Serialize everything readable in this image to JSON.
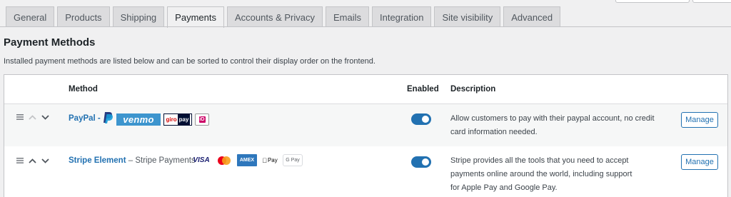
{
  "tabs": [
    "General",
    "Products",
    "Shipping",
    "Payments",
    "Accounts & Privacy",
    "Emails",
    "Integration",
    "Site visibility",
    "Advanced"
  ],
  "active_tab": "Payments",
  "page": {
    "title": "Payment Methods",
    "description": "Installed payment methods are listed below and can be sorted to control their display order on the frontend."
  },
  "table": {
    "headers": {
      "method": "Method",
      "enabled": "Enabled",
      "description": "Description"
    },
    "rows": [
      {
        "name": "PayPal -",
        "subtitle": "",
        "logos": [
          "paypal-logo",
          "venmo-logo",
          "giropay-logo",
          "ideal-logo"
        ],
        "logo_text": {
          "venmo": "venmo",
          "giropay_1": "giro",
          "giropay_2": "pay",
          "ideal": "iD"
        },
        "enabled": true,
        "description": "Allow customers to pay with their paypal account, no credit card information needed.",
        "manage_label": "Manage"
      },
      {
        "name": "Stripe Element",
        "subtitle": "– Stripe Payments",
        "logos": [
          "visa-logo",
          "mastercard-logo",
          "amex-logo",
          "apple-pay-logo",
          "google-pay-logo"
        ],
        "logo_text": {
          "visa": "VISA",
          "amex": "AMEX",
          "applepay": "Pay",
          "gpay": "G Pay"
        },
        "enabled": true,
        "description": "Stripe provides all the tools that you need to accept payments online around the world, including support for Apple Pay and Google Pay.",
        "manage_label": "Manage"
      }
    ]
  },
  "colors": {
    "accent": "#2271b1",
    "tab_bg": "#dcdcde",
    "page_bg": "#f0f0f1"
  }
}
